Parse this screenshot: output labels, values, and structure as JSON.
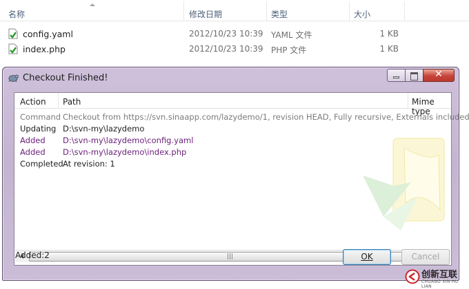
{
  "explorer": {
    "columns": {
      "name": "名称",
      "date": "修改日期",
      "type": "类型",
      "size": "大小"
    },
    "files": [
      {
        "name": "config.yaml",
        "date": "2012/10/23 10:39",
        "type": "YAML 文件",
        "size": "1 KB",
        "icon": "yaml-file-icon"
      },
      {
        "name": "index.php",
        "date": "2012/10/23 10:39",
        "type": "PHP 文件",
        "size": "1 KB",
        "icon": "php-file-icon"
      }
    ]
  },
  "dialog": {
    "title": "Checkout Finished!",
    "columns": {
      "action": "Action",
      "path": "Path",
      "mime": "Mime type"
    },
    "rows": [
      {
        "action": "Command",
        "path": "Checkout from https://svn.sinaapp.com/lazydemo/1, revision HEAD, Fully recursive, Externals included",
        "kind": "command"
      },
      {
        "action": "Updating",
        "path": "D:\\svn-my\\lazydemo",
        "kind": "normal"
      },
      {
        "action": "Added",
        "path": "D:\\svn-my\\lazydemo\\config.yaml",
        "kind": "added"
      },
      {
        "action": "Added",
        "path": "D:\\svn-my\\lazydemo\\index.php",
        "kind": "added"
      },
      {
        "action": "Completed",
        "path": "At revision: 1",
        "kind": "normal"
      }
    ],
    "status": "Added:2",
    "ok_label": "OK",
    "cancel_label": "Cancel",
    "colors": {
      "added": "#6a1f7a",
      "command": "#7b7b7b",
      "title_bg": "#cfc1db"
    }
  },
  "logo": {
    "name": "创新互联",
    "tagline": "CHUANG XIN HU LIAN"
  }
}
